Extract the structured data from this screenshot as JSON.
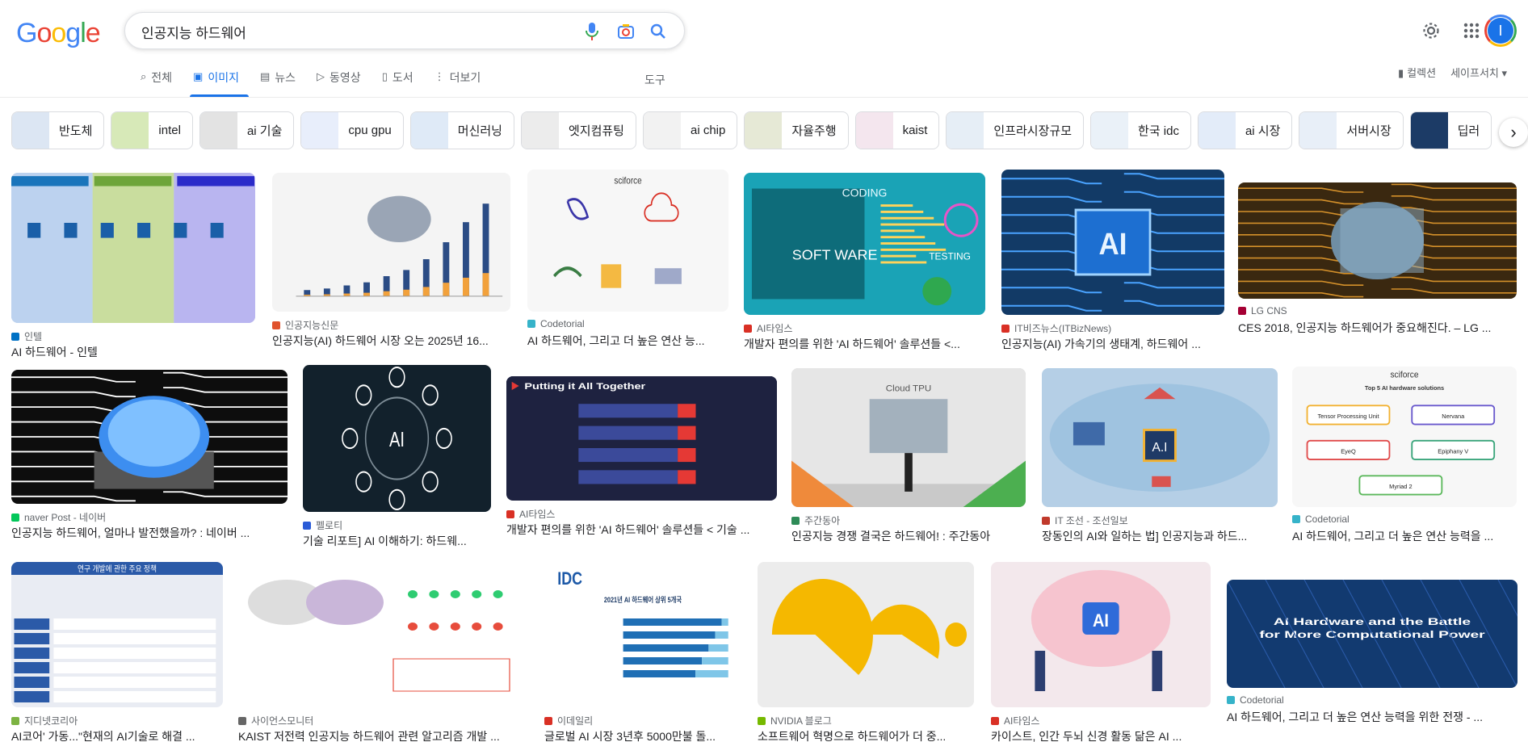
{
  "header": {
    "logo": "Google",
    "logo_colors": [
      "#4285f4",
      "#ea4335",
      "#fbbc05",
      "#4285f4",
      "#34a853",
      "#ea4335"
    ],
    "query": "인공지능 하드웨어",
    "icons": [
      "mic-icon",
      "camera-icon",
      "search-icon"
    ],
    "settings_icon": "gear-icon",
    "apps_icon": "apps-grid-icon",
    "avatar_letter": "I"
  },
  "tabs": [
    {
      "label": "전체",
      "icon": "⌕",
      "active": false
    },
    {
      "label": "이미지",
      "icon": "▣",
      "active": true
    },
    {
      "label": "뉴스",
      "icon": "▤",
      "active": false
    },
    {
      "label": "동영상",
      "icon": "▷",
      "active": false
    },
    {
      "label": "도서",
      "icon": "▯",
      "active": false
    },
    {
      "label": "더보기",
      "icon": "⋮",
      "active": false
    }
  ],
  "tools_label": "도구",
  "right_links": {
    "collections": "컬렉션",
    "safesearch": "세이프서치 ▾"
  },
  "chips": [
    "반도체",
    "intel",
    "ai 기술",
    "cpu gpu",
    "머신러닝",
    "엣지컴퓨팅",
    "ai chip",
    "자율주행",
    "kaist",
    "인프라시장규모",
    "한국 idc",
    "ai 시장",
    "서버시장",
    "딥러"
  ],
  "results": [
    {
      "source": "인텔",
      "title": "AI 하드웨어 - 인텔",
      "fav": "#0071c5",
      "bg": "#c7d7ee"
    },
    {
      "source": "인공지능신문",
      "title": "인공지능(AI) 하드웨어 시장 오는 2025년 16...",
      "fav": "#e0522d",
      "bg": "#f4f4f4"
    },
    {
      "source": "Codetorial",
      "title": "AI 하드웨어, 그리고 더 높은 연산 능...",
      "fav": "#36b3c9",
      "bg": "#f7f7f7"
    },
    {
      "source": "AI타임스",
      "title": "개발자 편의를 위한 'AI 하드웨어' 솔루션들 <...",
      "fav": "#d93025",
      "bg": "#1aa3b6"
    },
    {
      "source": "IT비즈뉴스(ITBizNews)",
      "title": "인공지능(AI) 가속기의 생태계, 하드웨어 ...",
      "fav": "#d93025",
      "bg": "#123a66"
    },
    {
      "source": "LG CNS",
      "title": "CES 2018, 인공지능 하드웨어가 중요해진다. – LG ...",
      "fav": "#a50034",
      "bg": "#3a2810"
    },
    {
      "source": "naver Post - 네이버",
      "title": "인공지능 하드웨어, 얼마나 발전했을까? : 네이버 ...",
      "fav": "#03c75a",
      "bg": "#0d0d0d"
    },
    {
      "source": "펠로티",
      "title": "기술 리포트] AI 이해하기: 하드웨...",
      "fav": "#2a5bd7",
      "bg": "#12212c"
    },
    {
      "source": "AI타임스",
      "title": "개발자 편의를 위한 'AI 하드웨어' 솔루션들 < 기술 ...",
      "fav": "#d93025",
      "bg": "#1e2240"
    },
    {
      "source": "주간동아",
      "title": "인공지능 경쟁 결국은 하드웨어! : 주간동아",
      "fav": "#2e8b57",
      "bg": "#c9c9c9"
    },
    {
      "source": "IT 조선 - 조선일보",
      "title": "장동인의 AI와 일하는 법] 인공지능과 하드...",
      "fav": "#c0392b",
      "bg": "#b5cfe6"
    },
    {
      "source": "Codetorial",
      "title": "AI 하드웨어, 그리고 더 높은 연산 능력을 ...",
      "fav": "#36b3c9",
      "bg": "#f7f7f7"
    },
    {
      "source": "지디넷코리아",
      "title": "AI코어' 가동...\"현재의 AI기술로 해결 ...",
      "fav": "#7cb342",
      "bg": "#e9ecf3"
    },
    {
      "source": "사이언스모니터",
      "title": "KAIST 저전력 인공지능 하드웨어 관련 알고리즘 개발 ...",
      "fav": "#666666",
      "bg": "#ffffff"
    },
    {
      "source": "이데일리",
      "title": "글로벌 AI 시장 3년후 5000만불 돌...",
      "fav": "#d93025",
      "bg": "#ffffff"
    },
    {
      "source": "NVIDIA 블로그",
      "title": "소프트웨어 혁명으로 하드웨어가 더 중...",
      "fav": "#76b900",
      "bg": "#ececec"
    },
    {
      "source": "AI타임스",
      "title": "카이스트, 인간 두뇌 신경 활동 닮은 AI ...",
      "fav": "#d93025",
      "bg": "#f3e8ec"
    },
    {
      "source": "Codetorial",
      "title": "AI 하드웨어, 그리고 더 높은 연산 능력을 위한 전쟁 - ...",
      "fav": "#36b3c9",
      "bg": "#123a70"
    }
  ],
  "image_text": {
    "r3": "sciforce",
    "r4a": "CODING",
    "r4b": "SOFT WARE",
    "r4c": "TESTING",
    "r5": "AI",
    "r8": "AI",
    "r9": "Putting it All Together",
    "r10": "Cloud TPU",
    "r11": "A.I",
    "r12": "sciforce",
    "r12b": "Top 5 AI hardware solutions",
    "r12_items": [
      "Tensor Processing Unit",
      "Nervana",
      "EyeQ",
      "Epiphany V",
      "Myriad 2"
    ],
    "r13": "연구 개발에 관한 주요 정책",
    "r15": "IDC",
    "r15b": "2021년 AI 하드웨어 상위 5개국",
    "r17": "AI",
    "r18": "AI Hardware and the Battle for More Computational Power"
  }
}
